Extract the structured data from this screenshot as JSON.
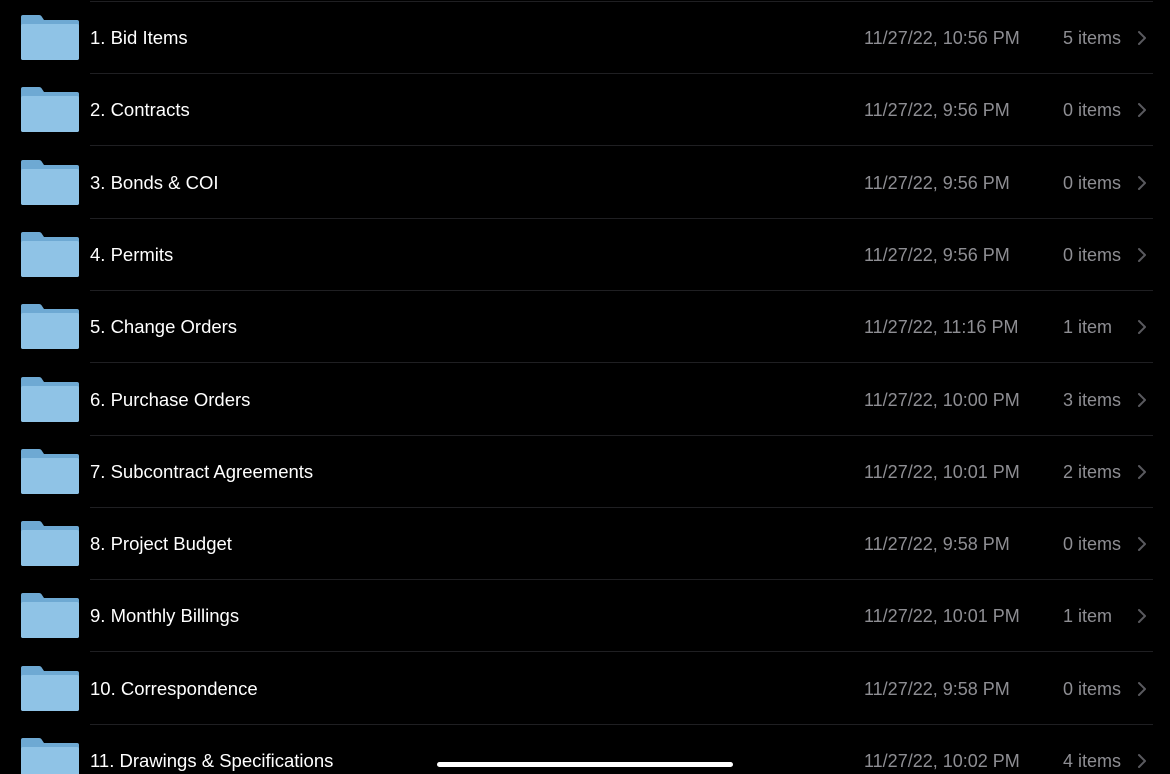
{
  "theme": {
    "background": "#000000",
    "primary_text": "#ffffff",
    "secondary_text": "#8e8e93",
    "separator": "#1f1f22",
    "folder_front": "#8fc3e6",
    "folder_back": "#6ea9d3"
  },
  "folders": [
    {
      "name": "1. Bid Items",
      "date": "11/27/22, 10:56 PM",
      "count": "5 items",
      "icon": "folder-icon"
    },
    {
      "name": "2. Contracts",
      "date": "11/27/22, 9:56 PM",
      "count": "0 items",
      "icon": "folder-icon"
    },
    {
      "name": "3. Bonds & COI",
      "date": "11/27/22, 9:56 PM",
      "count": "0 items",
      "icon": "folder-icon"
    },
    {
      "name": "4. Permits",
      "date": "11/27/22, 9:56 PM",
      "count": "0 items",
      "icon": "folder-icon"
    },
    {
      "name": "5. Change Orders",
      "date": "11/27/22, 11:16 PM",
      "count": "1 item",
      "icon": "folder-icon"
    },
    {
      "name": "6. Purchase Orders",
      "date": "11/27/22, 10:00 PM",
      "count": "3 items",
      "icon": "folder-icon"
    },
    {
      "name": "7. Subcontract Agreements",
      "date": "11/27/22, 10:01 PM",
      "count": "2 items",
      "icon": "folder-icon"
    },
    {
      "name": "8. Project Budget",
      "date": "11/27/22, 9:58 PM",
      "count": "0 items",
      "icon": "folder-icon"
    },
    {
      "name": "9. Monthly Billings",
      "date": "11/27/22, 10:01 PM",
      "count": "1 item",
      "icon": "folder-icon"
    },
    {
      "name": "10. Correspondence",
      "date": "11/27/22, 9:58 PM",
      "count": "0 items",
      "icon": "folder-icon"
    },
    {
      "name": "11. Drawings & Specifications",
      "date": "11/27/22, 10:02 PM",
      "count": "4 items",
      "icon": "folder-icon"
    }
  ]
}
